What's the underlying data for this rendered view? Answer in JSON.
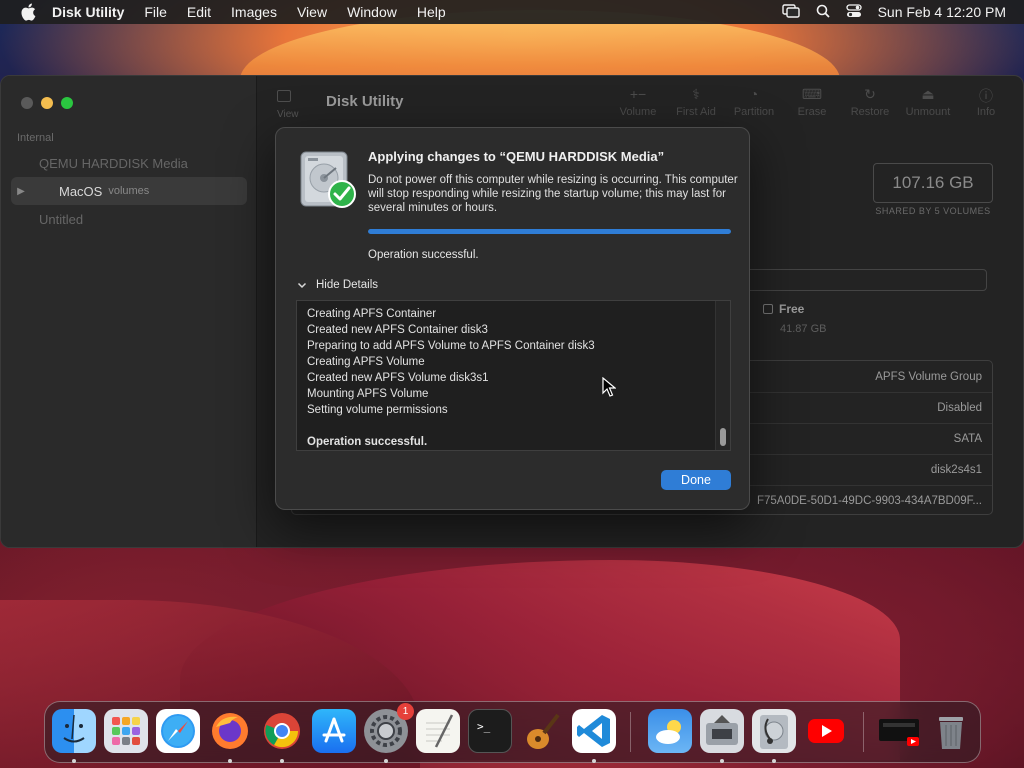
{
  "menubar": {
    "app_name": "Disk Utility",
    "menus": [
      "File",
      "Edit",
      "Images",
      "View",
      "Window",
      "Help"
    ],
    "clock": "Sun Feb 4  12:20 PM",
    "status_icons": [
      "screen-mirroring-icon",
      "search-icon",
      "control-center-icon"
    ]
  },
  "window": {
    "title": "Disk Utility",
    "view_label": "View",
    "sidebar": {
      "section": "Internal",
      "items": [
        {
          "label": "QEMU HARDDISK Media",
          "sub": ""
        },
        {
          "label": "MacOS",
          "sub": "volumes"
        },
        {
          "label": "Untitled",
          "sub": ""
        }
      ]
    },
    "toolbar": [
      "Volume",
      "First Aid",
      "Partition",
      "Erase",
      "Restore",
      "Unmount",
      "Info"
    ],
    "capacity": "107.16 GB",
    "capacity_sub": "SHARED BY 5 VOLUMES",
    "free_label": "Free",
    "free_value": "41.87 GB",
    "info_rows": [
      "APFS Volume Group",
      "Disabled",
      "SATA",
      "disk2s4s1",
      "F75A0DE-50D1-49DC-9903-434A7BD09F..."
    ]
  },
  "dialog": {
    "heading": "Applying changes to “QEMU HARDDISK Media”",
    "message": "Do not power off this computer while resizing is occurring. This computer will stop responding while resizing the startup volume; this may last for several minutes or hours.",
    "progress": 1.0,
    "status": "Operation successful.",
    "details_toggle": "Hide Details",
    "log_lines": [
      "Creating APFS Container",
      "Created new APFS Container disk3",
      "Preparing to add APFS Volume to APFS Container disk3",
      "Creating APFS Volume",
      "Created new APFS Volume disk3s1",
      "Mounting APFS Volume",
      "Setting volume permissions",
      "",
      "Operation successful."
    ],
    "done_label": "Done"
  },
  "dock": {
    "apps": [
      "Finder",
      "Launchpad",
      "Safari",
      "Firefox",
      "Chrome",
      "App Store",
      "System Settings",
      "TextEdit",
      "Terminal",
      "GarageBand",
      "Visual Studio Code",
      "Weather",
      "Boot Camp",
      "Disk Utility",
      "YouTube",
      "Screen Recorder",
      "Trash"
    ],
    "settings_badge": "1"
  },
  "colors": {
    "accent": "#2f7dd6",
    "traffic_close": "#5a5a5a",
    "traffic_min": "#f4bd4f",
    "traffic_max": "#2ac640"
  }
}
